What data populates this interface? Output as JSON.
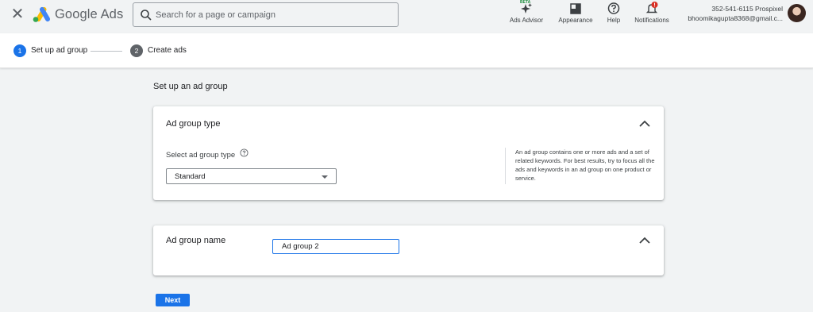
{
  "header": {
    "brand": "Google Ads",
    "search_placeholder": "Search for a page or campaign",
    "tools": [
      {
        "label": "Ads Advisor",
        "badge": "BETA",
        "icon": "sparkle-icon"
      },
      {
        "label": "Appearance",
        "icon": "appearance-icon"
      },
      {
        "label": "Help",
        "icon": "help-circle-icon"
      },
      {
        "label": "Notifications",
        "icon": "bell-icon"
      }
    ],
    "account": {
      "id_line": "352-541-6115 Prospixel",
      "email": "bhoomikagupta8368@gmail.c..."
    }
  },
  "stepper": {
    "steps": [
      {
        "number": "1",
        "label": "Set up ad group",
        "active": true
      },
      {
        "number": "2",
        "label": "Create ads",
        "active": false
      }
    ]
  },
  "main": {
    "title": "Set up an ad group",
    "ad_group_type": {
      "title": "Ad group type",
      "field_label": "Select ad group type",
      "selected": "Standard",
      "help_text": "An ad group contains one or more ads and a set of related keywords. For best results, try to focus all the ads and keywords in an ad group on one product or service."
    },
    "ad_group_name": {
      "title": "Ad group name",
      "value": "Ad group 2"
    },
    "next_label": "Next"
  },
  "colors": {
    "accent": "#1a73e8",
    "background": "#f1f3f4",
    "notification_badge": "#d93025"
  }
}
